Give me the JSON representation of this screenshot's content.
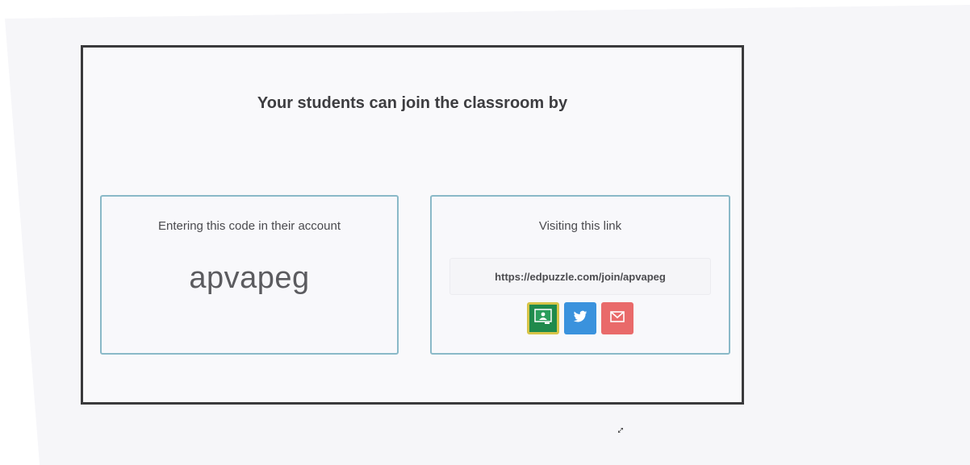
{
  "dialog": {
    "heading": "Your students can join the classroom by"
  },
  "code_card": {
    "title": "Entering this code in their account",
    "code": "apvapeg"
  },
  "link_card": {
    "title": "Visiting this link",
    "url": "https://edpuzzle.com/join/apvapeg",
    "share_buttons": [
      {
        "icon": "google-classroom-icon",
        "color": "#1f8a4c"
      },
      {
        "icon": "twitter-icon",
        "color": "#3a92dd"
      },
      {
        "icon": "email-icon",
        "color": "#e96a6a"
      }
    ]
  }
}
